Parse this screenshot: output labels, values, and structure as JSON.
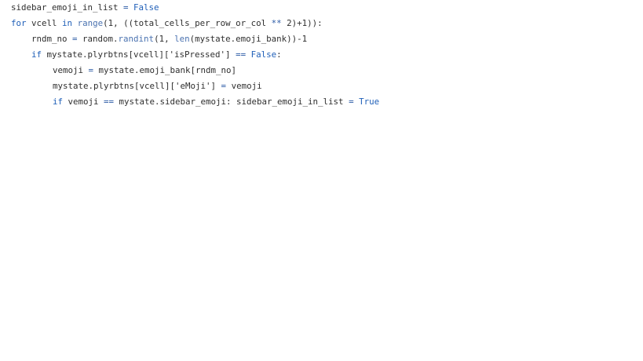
{
  "code": {
    "lines": [
      {
        "indent": 0,
        "tokens": [
          {
            "t": "sidebar_emoji_in_list ",
            "c": "plain"
          },
          {
            "t": "=",
            "c": "op"
          },
          {
            "t": " ",
            "c": "plain"
          },
          {
            "t": "False",
            "c": "kw"
          }
        ]
      },
      {
        "indent": 0,
        "tokens": [
          {
            "t": "for",
            "c": "kw"
          },
          {
            "t": " vcell ",
            "c": "plain"
          },
          {
            "t": "in",
            "c": "kw"
          },
          {
            "t": " ",
            "c": "plain"
          },
          {
            "t": "range",
            "c": "bi"
          },
          {
            "t": "(1, ((total_cells_per_row_or_col ",
            "c": "plain"
          },
          {
            "t": "**",
            "c": "op"
          },
          {
            "t": " 2)+1)):",
            "c": "plain"
          }
        ]
      },
      {
        "indent": 1,
        "tokens": [
          {
            "t": "rndm_no ",
            "c": "plain"
          },
          {
            "t": "=",
            "c": "op"
          },
          {
            "t": " random.",
            "c": "plain"
          },
          {
            "t": "randint",
            "c": "bi"
          },
          {
            "t": "(1, ",
            "c": "plain"
          },
          {
            "t": "len",
            "c": "bi"
          },
          {
            "t": "(mystate.emoji_bank))-1",
            "c": "plain"
          }
        ]
      },
      {
        "indent": 1,
        "tokens": [
          {
            "t": "if",
            "c": "kw"
          },
          {
            "t": " mystate.plyrbtns[vcell][",
            "c": "plain"
          },
          {
            "t": "'isPressed'",
            "c": "str"
          },
          {
            "t": "] ",
            "c": "plain"
          },
          {
            "t": "==",
            "c": "op"
          },
          {
            "t": " ",
            "c": "plain"
          },
          {
            "t": "False",
            "c": "kw"
          },
          {
            "t": ":",
            "c": "plain"
          }
        ]
      },
      {
        "indent": 2,
        "tokens": [
          {
            "t": "vemoji ",
            "c": "plain"
          },
          {
            "t": "=",
            "c": "op"
          },
          {
            "t": " mystate.emoji_bank[rndm_no]",
            "c": "plain"
          }
        ]
      },
      {
        "indent": 2,
        "tokens": [
          {
            "t": "mystate.plyrbtns[vcell][",
            "c": "plain"
          },
          {
            "t": "'eMoji'",
            "c": "str"
          },
          {
            "t": "] ",
            "c": "plain"
          },
          {
            "t": "=",
            "c": "op"
          },
          {
            "t": " vemoji",
            "c": "plain"
          }
        ]
      },
      {
        "indent": 2,
        "tokens": [
          {
            "t": "if",
            "c": "kw"
          },
          {
            "t": " vemoji ",
            "c": "plain"
          },
          {
            "t": "==",
            "c": "op"
          },
          {
            "t": " mystate.sidebar_emoji: sidebar_emoji_in_list ",
            "c": "plain"
          },
          {
            "t": "=",
            "c": "op"
          },
          {
            "t": " ",
            "c": "plain"
          },
          {
            "t": "True",
            "c": "kw"
          }
        ]
      }
    ]
  }
}
